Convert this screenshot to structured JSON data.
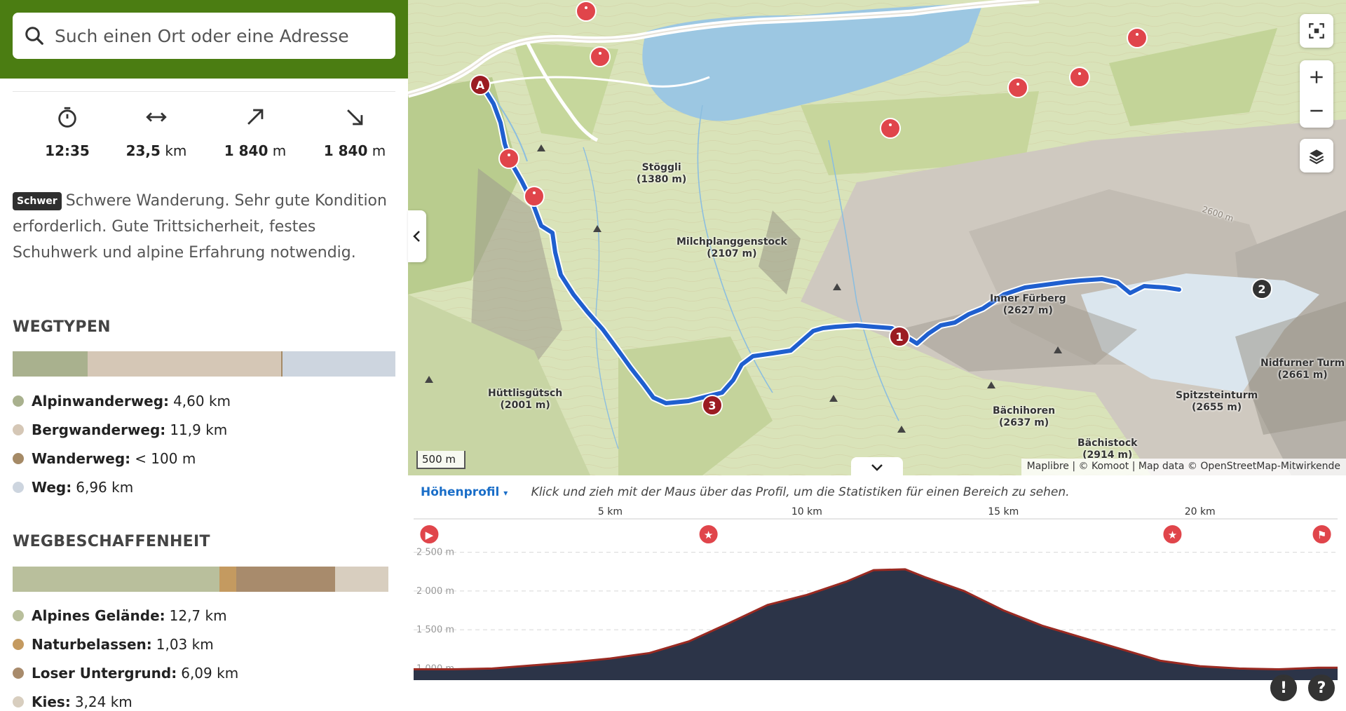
{
  "search": {
    "placeholder": "Such einen Ort oder eine Adresse",
    "icon": "search-icon"
  },
  "stats": [
    {
      "icon": "stopwatch-icon",
      "value": "12:35",
      "unit": ""
    },
    {
      "icon": "distance-icon",
      "value": "23,5",
      "unit": "km"
    },
    {
      "icon": "uphill-icon",
      "value": "1 840",
      "unit": "m"
    },
    {
      "icon": "downhill-icon",
      "value": "1 840",
      "unit": "m"
    }
  ],
  "difficulty": {
    "badge": "Schwer",
    "text": "Schwere Wanderung. Sehr gute Kondition erforderlich. Gute Trittsicherheit, festes Schuhwerk und alpine Erfahrung notwendig."
  },
  "waytypes": {
    "title": "WEGTYPEN",
    "items": [
      {
        "label": "Alpinwanderweg:",
        "value": "4,60 km",
        "color": "#a9b18e",
        "fraction": 0.196
      },
      {
        "label": "Bergwanderweg:",
        "value": "11,9 km",
        "color": "#d5c7b6",
        "fraction": 0.506
      },
      {
        "label": "Wanderweg:",
        "value": "< 100 m",
        "color": "#a58a66",
        "fraction": 0.003
      },
      {
        "label": "Weg:",
        "value": "6,96 km",
        "color": "#cdd5df",
        "fraction": 0.295
      }
    ]
  },
  "surfaces": {
    "title": "WEGBESCHAFFENHEIT",
    "items": [
      {
        "label": "Alpines Gelände:",
        "value": "12,7 km",
        "color": "#b9bf9c",
        "fraction": 0.54
      },
      {
        "label": "Naturbelassen:",
        "value": "1,03 km",
        "color": "#c49a60",
        "fraction": 0.044
      },
      {
        "label": "Loser Untergrund:",
        "value": "6,09 km",
        "color": "#a88b6c",
        "fraction": 0.259
      },
      {
        "label": "Kies:",
        "value": "3,24 km",
        "color": "#d8cebf",
        "fraction": 0.138
      }
    ]
  },
  "map": {
    "scale": "500 m",
    "attribution": "Maplibre | © Komoot | Map data © OpenStreetMap-Mitwirkende",
    "route_color": "#1f5fcf",
    "peaks": [
      {
        "name": "Stöggli",
        "elev": "(1380 m)"
      },
      {
        "name": "Milchplanggenstock",
        "elev": "(2107 m)"
      },
      {
        "name": "Hüttlisgütsch",
        "elev": "(2001 m)"
      },
      {
        "name": "Inner Fürberg",
        "elev": "(2627 m)"
      },
      {
        "name": "Bächihoren",
        "elev": "(2637 m)"
      },
      {
        "name": "Spitzsteinturm",
        "elev": "(2655 m)"
      },
      {
        "name": "Nidfurner Turm",
        "elev": "(2661 m)"
      },
      {
        "name": "Bächistock",
        "elev": "(2914 m)"
      }
    ],
    "contour_label": "2600 m",
    "waypoints": [
      "A",
      "1",
      "2",
      "3"
    ]
  },
  "profile": {
    "selector": "Höhenprofil",
    "hint": "Klick und zieh mit der Maus über das Profil, um die Statistiken für einen Bereich zu sehen.",
    "x_ticks": [
      "5 km",
      "10 km",
      "15 km",
      "20 km"
    ],
    "y_ticks": [
      "2 500 m",
      "2 000 m",
      "1 500 m",
      "1 000 m"
    ]
  },
  "chart_data": {
    "type": "area",
    "title": "",
    "xlabel": "",
    "ylabel": "",
    "xlim": [
      0,
      23.5
    ],
    "ylim": [
      850,
      2750
    ],
    "x": [
      0,
      1,
      2,
      3,
      4,
      5,
      6,
      7,
      8,
      9,
      10,
      11,
      11.7,
      12.5,
      13,
      14,
      15,
      16,
      17,
      18,
      19,
      20,
      21,
      22,
      23,
      23.5
    ],
    "series": [
      {
        "values": [
          990,
          990,
          1000,
          1040,
          1080,
          1130,
          1200,
          1350,
          1580,
          1820,
          1950,
          2120,
          2270,
          2280,
          2180,
          2000,
          1750,
          1550,
          1400,
          1250,
          1100,
          1030,
          1000,
          990,
          1010,
          1010
        ]
      }
    ]
  }
}
